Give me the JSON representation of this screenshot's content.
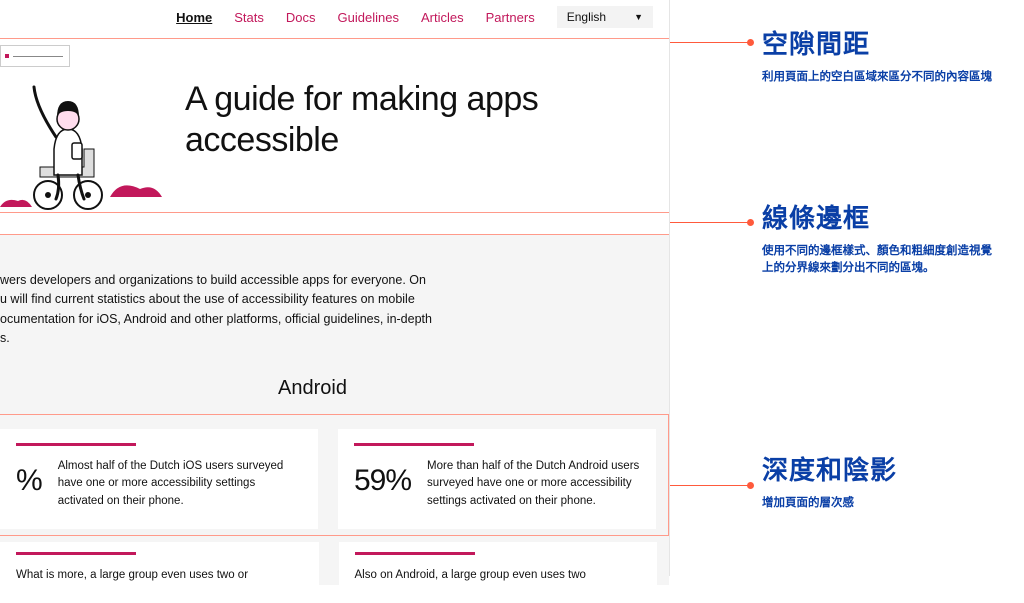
{
  "nav": {
    "items": [
      {
        "label": "Home",
        "active": true
      },
      {
        "label": "Stats"
      },
      {
        "label": "Docs"
      },
      {
        "label": "Guidelines"
      },
      {
        "label": "Articles"
      },
      {
        "label": "Partners"
      }
    ],
    "language": "English"
  },
  "hero": {
    "title_line1": "A guide for making apps",
    "title_line2": "accessible"
  },
  "intro": {
    "line1": "wers developers and organizations to build accessible apps for everyone. On",
    "line2": "u will find current statistics about the use of accessibility features on mobile",
    "line3": "ocumentation for iOS, Android and other platforms, official guidelines, in-depth",
    "line4": "s."
  },
  "platform": "Android",
  "cards": [
    {
      "pct": "%",
      "desc": "Almost half of the Dutch iOS users surveyed have one or more accessibility settings activated on their phone."
    },
    {
      "pct": "59%",
      "desc": "More than half of the Dutch Android users surveyed have one or more accessibility settings activated on their phone."
    }
  ],
  "cards_row2": [
    {
      "desc": "What is more, a large group even uses two or"
    },
    {
      "desc": "Also on Android, a large group even uses two"
    }
  ],
  "annotations": {
    "a1": {
      "title": "空隙間距",
      "desc": "利用頁面上的空白區域來區分不同的內容區塊"
    },
    "a2": {
      "title": "線條邊框",
      "desc": "使用不同的邊框樣式、顏色和粗細度創造視覺上的分界線來劃分出不同的區塊。"
    },
    "a3": {
      "title": "深度和陰影",
      "desc": "增加頁面的層次感"
    }
  }
}
